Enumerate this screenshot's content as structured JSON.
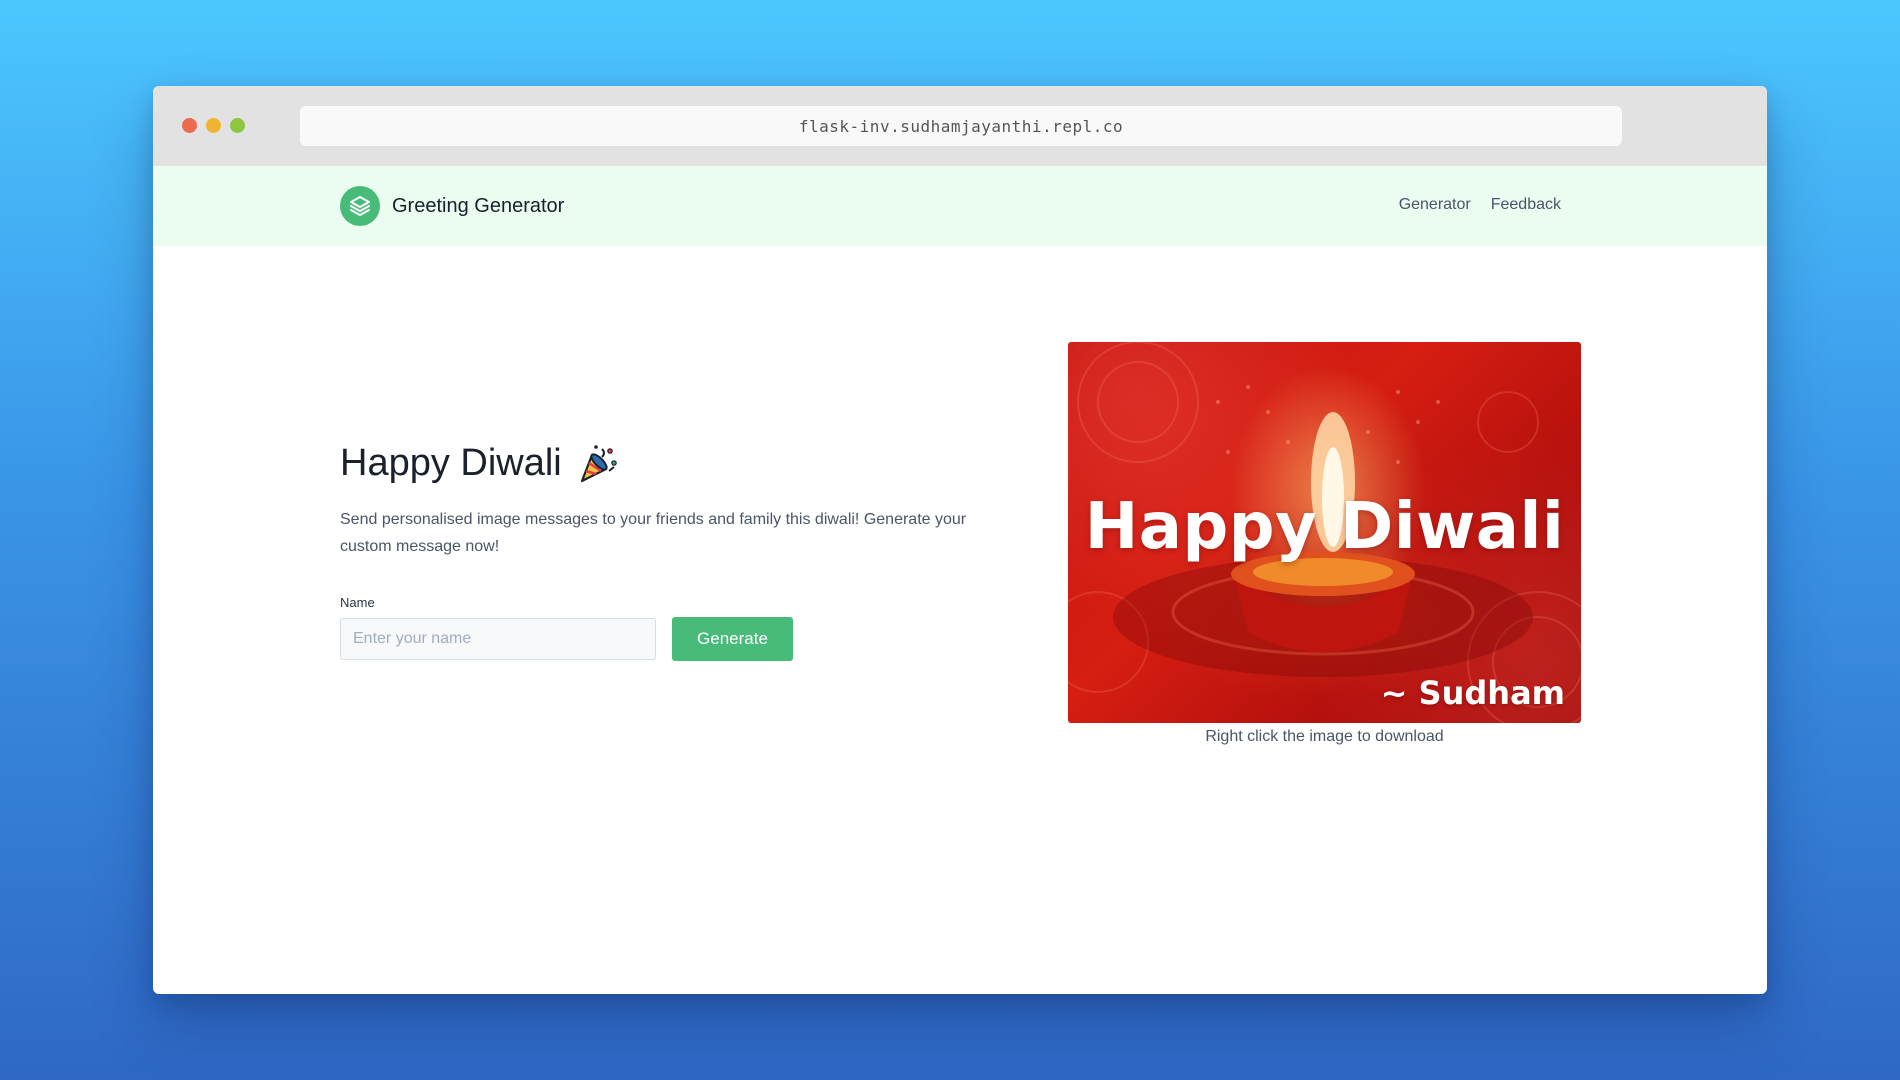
{
  "browser": {
    "url": "flask-inv.sudhamjayanthi.repl.co",
    "traffic_lights": {
      "close": "#ee6a4f",
      "minimize": "#f0b332",
      "zoom": "#8dc63f"
    }
  },
  "navbar": {
    "brand_icon": "layers-icon",
    "brand_name": "Greeting Generator",
    "links": [
      "Generator",
      "Feedback"
    ],
    "background": "#ebfcf0"
  },
  "hero": {
    "title": "Happy Diwali",
    "title_icon": "party-popper-icon",
    "description": "Send personalised image messages to your friends and family this diwali! Generate your custom message now!"
  },
  "form": {
    "label": "Name",
    "placeholder": "Enter your name",
    "value": "",
    "button_label": "Generate",
    "accent": "#48bb78"
  },
  "preview": {
    "card_title": "Happy Diwali",
    "card_signature": "~ Sudham",
    "caption": "Right click the image to download"
  }
}
